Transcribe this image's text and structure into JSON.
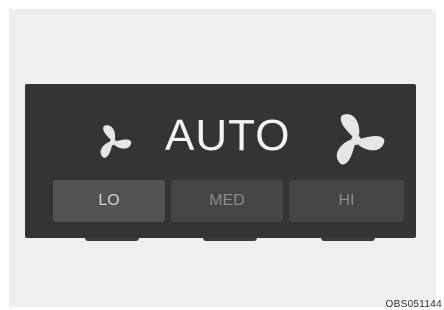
{
  "panel": {
    "mode_label": "AUTO",
    "fan_icons": [
      "fan-low-icon",
      "fan-high-icon"
    ],
    "buttons": [
      {
        "label": "LO",
        "selected": true
      },
      {
        "label": "MED",
        "selected": false
      },
      {
        "label": "HI",
        "selected": false
      }
    ]
  },
  "figure_code": "OBS051144",
  "colors": {
    "panel_bg": "#333435",
    "button_selected": "#505254",
    "button_default": "#434546",
    "text_light": "#f4f4f4",
    "text_dim": "#8a8c8d"
  }
}
